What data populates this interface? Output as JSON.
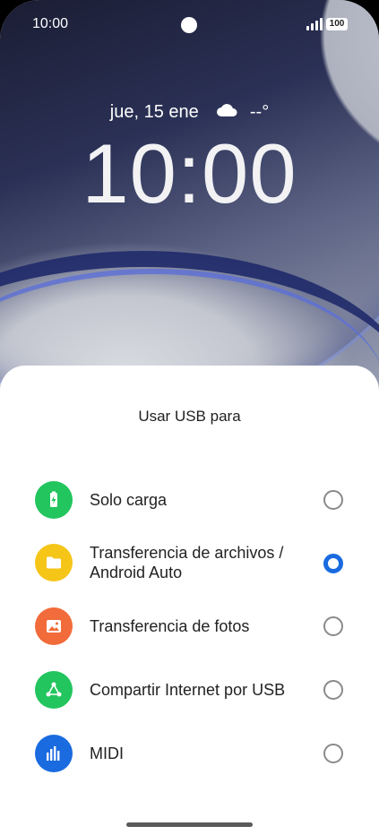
{
  "status_bar": {
    "time": "10:00",
    "battery": "100"
  },
  "lockscreen": {
    "date": "jue, 15 ene",
    "weather": "--°",
    "time": "10:00"
  },
  "sheet": {
    "title": "Usar USB para",
    "options": [
      {
        "label": "Solo carga",
        "icon": "battery-charging-icon",
        "color": "#22c55e",
        "selected": false
      },
      {
        "label": "Transferencia de archivos / Android Auto",
        "icon": "folder-icon",
        "color": "#f5c518",
        "selected": true
      },
      {
        "label": "Transferencia de fotos",
        "icon": "image-icon",
        "color": "#f26b3a",
        "selected": false
      },
      {
        "label": "Compartir Internet por USB",
        "icon": "share-network-icon",
        "color": "#22c55e",
        "selected": false
      },
      {
        "label": "MIDI",
        "icon": "equalizer-icon",
        "color": "#1a6be0",
        "selected": false
      }
    ]
  },
  "colors": {
    "accent": "#1a6be0",
    "sheet_bg": "#ffffff"
  }
}
